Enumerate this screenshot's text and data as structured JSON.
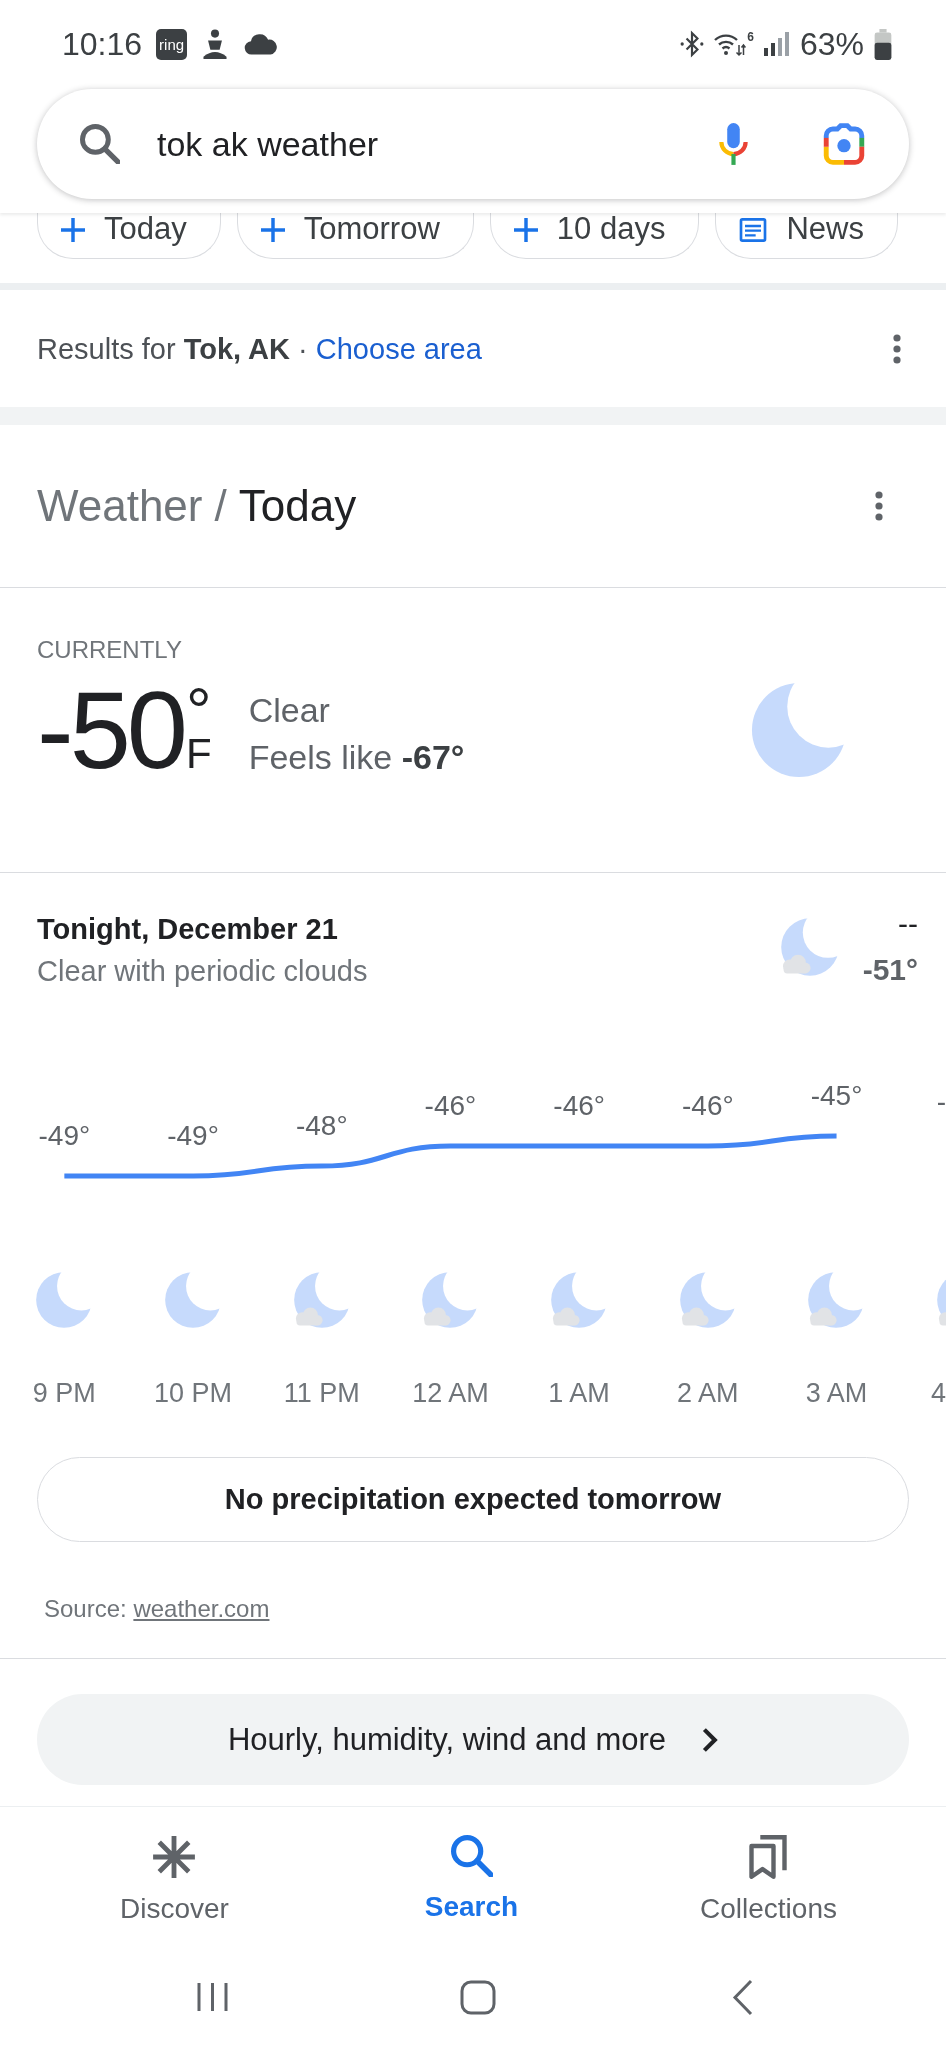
{
  "status_bar": {
    "time": "10:16",
    "app_badge": "ring",
    "wifi_label": "6",
    "battery": "63%"
  },
  "search": {
    "query": "tok ak weather"
  },
  "chips": [
    {
      "kind": "add",
      "label": "Today"
    },
    {
      "kind": "add",
      "label": "Tomorrow"
    },
    {
      "kind": "add",
      "label": "10 days"
    },
    {
      "kind": "news",
      "label": "News"
    }
  ],
  "location": {
    "text": "Results for **Tok, AK** ·",
    "link": "Choose area"
  },
  "weather": {
    "breadcrumb": [
      {
        "label": "Weather",
        "selected": false
      },
      {
        "label": "Today",
        "selected": true
      }
    ],
    "separator": "/",
    "current": {
      "label": "CURRENTLY",
      "temperature": "-50",
      "degree": "°",
      "unit": "F",
      "condition": "Clear",
      "feels_like": "Feels like **-67°**",
      "kind": "clear_night"
    },
    "tonight": {
      "title": "Tonight, December 21",
      "summary": "Clear with periodic clouds",
      "kind": "partly_cloudy_night",
      "high": "--",
      "low": "-51°"
    },
    "hourly": {
      "chart_data": {
        "type": "line",
        "categories": [
          "9 PM",
          "10 PM",
          "11 PM",
          "12 AM",
          "1 AM",
          "2 AM",
          "3 AM"
        ],
        "values": [
          -49,
          -49,
          -48,
          -46,
          -46,
          -46,
          -45
        ],
        "data_labels": true,
        "value_labels": [
          "-49°",
          "-49°",
          "-48°",
          "-46°",
          "-46°",
          "-46°",
          "-45°"
        ]
      },
      "icons": [
        {
          "kind": "clear_night"
        },
        {
          "kind": "clear_night"
        },
        {
          "kind": "partly_cloudy_night"
        },
        {
          "kind": "partly_cloudy_night"
        },
        {
          "kind": "partly_cloudy_night"
        },
        {
          "kind": "partly_cloudy_night"
        },
        {
          "kind": "partly_cloudy_night"
        }
      ],
      "cut_off_hour": {
        "value_label": "-",
        "time": "4",
        "kind": "partly_cloudy_night"
      }
    },
    "precipitation": "No precipitation expected tomorrow",
    "source": {
      "label": "Source:",
      "link": "weather.com"
    },
    "more_button": "Hourly, humidity, wind and more"
  },
  "bottom_nav": [
    {
      "kind": "discover",
      "label": "Discover",
      "selected": false
    },
    {
      "kind": "search",
      "label": "Search",
      "selected": true
    },
    {
      "kind": "collections",
      "label": "Collections",
      "selected": false
    }
  ]
}
